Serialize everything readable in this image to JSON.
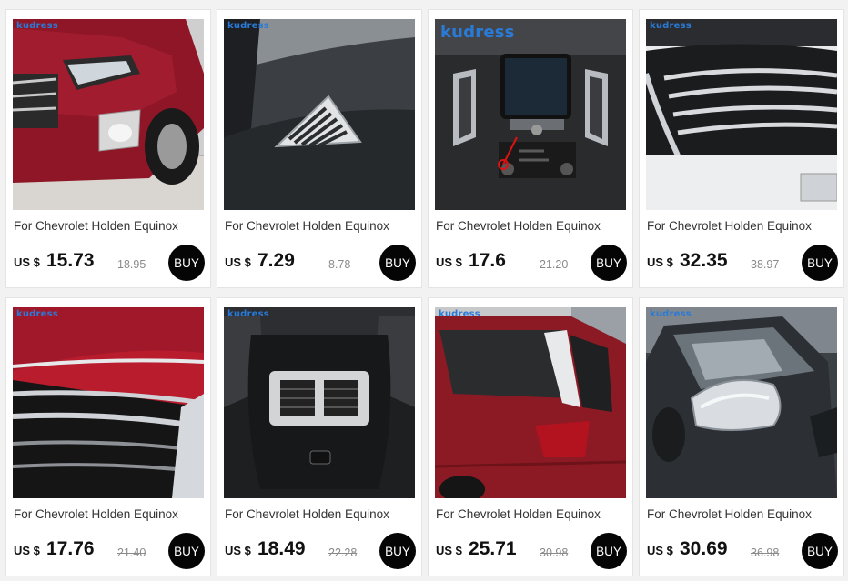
{
  "colors": {
    "background": "#f2f2f2",
    "card": "#ffffff",
    "buy_button": "#050505",
    "old_price": "#8a8a8a"
  },
  "products": [
    {
      "image": "red-suv-front-fog-lamp-photo",
      "brand": "kudress",
      "title": "For Chevrolet Holden Equinox",
      "currency": "US $",
      "price": "15.73",
      "old_price": "18.95",
      "buy": "BUY"
    },
    {
      "image": "dashboard-air-vent-trim-photo",
      "brand": "kudress",
      "title": "For Chevrolet Holden Equinox",
      "currency": "US $",
      "price": "7.29",
      "old_price": "8.78",
      "buy": "BUY"
    },
    {
      "image": "center-console-screen-photo",
      "brand": "kudress",
      "title": "For Chevrolet Holden Equinox",
      "currency": "US $",
      "price": "17.6",
      "old_price": "21.20",
      "buy": "BUY"
    },
    {
      "image": "white-suv-front-grille-photo",
      "brand": "kudress",
      "title": "For Chevrolet Holden Equinox",
      "currency": "US $",
      "price": "32.35",
      "old_price": "38.97",
      "buy": "BUY"
    },
    {
      "image": "red-suv-hood-grille-photo",
      "brand": "kudress",
      "title": "For Chevrolet Holden Equinox",
      "currency": "US $",
      "price": "17.76",
      "old_price": "21.40",
      "buy": "BUY"
    },
    {
      "image": "rear-seat-air-vent-photo",
      "brand": "kudress",
      "title": "For Chevrolet Holden Equinox",
      "currency": "US $",
      "price": "18.49",
      "old_price": "22.28",
      "buy": "BUY"
    },
    {
      "image": "red-suv-rear-window-trim-photo",
      "brand": "kudress",
      "title": "For Chevrolet Holden Equinox",
      "currency": "US $",
      "price": "25.71",
      "old_price": "30.98",
      "buy": "BUY"
    },
    {
      "image": "chrome-side-mirror-cover-photo",
      "brand": "kudress",
      "title": "For Chevrolet Holden Equinox",
      "currency": "US $",
      "price": "30.69",
      "old_price": "36.98",
      "buy": "BUY"
    }
  ]
}
